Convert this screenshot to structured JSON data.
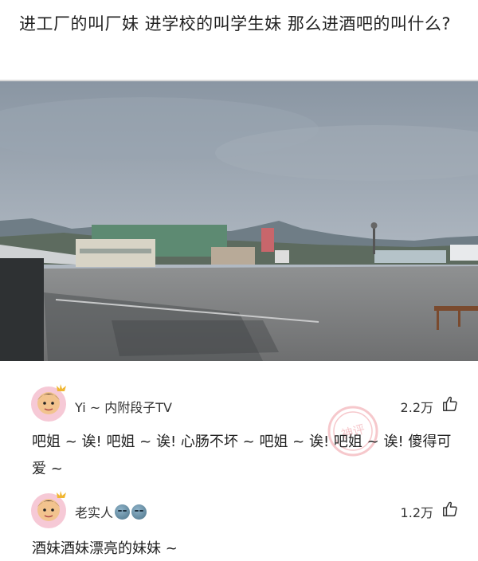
{
  "post": {
    "title": "进工厂的叫厂妹  进学校的叫学生妹 那么进酒吧的叫什么?"
  },
  "photo": {
    "description_icon": "photo-rooftop-icon"
  },
  "comments": [
    {
      "username": "Yi ~ 内附段子TV",
      "likes": "2.2万",
      "text": "吧姐 ~ 诶! 吧姐 ~ 诶! 心肠不坏 ~ 吧姐 ~ 诶! 吧姐 ~ 诶! 傻得可爱 ~",
      "badge": "神评"
    },
    {
      "username": "老实人",
      "likes": "1.2万",
      "text": "酒妹酒妹漂亮的妹妹 ~"
    }
  ],
  "colors": {
    "divider": "#d9d9d9",
    "text": "#222222",
    "badge": "#e8646e"
  }
}
